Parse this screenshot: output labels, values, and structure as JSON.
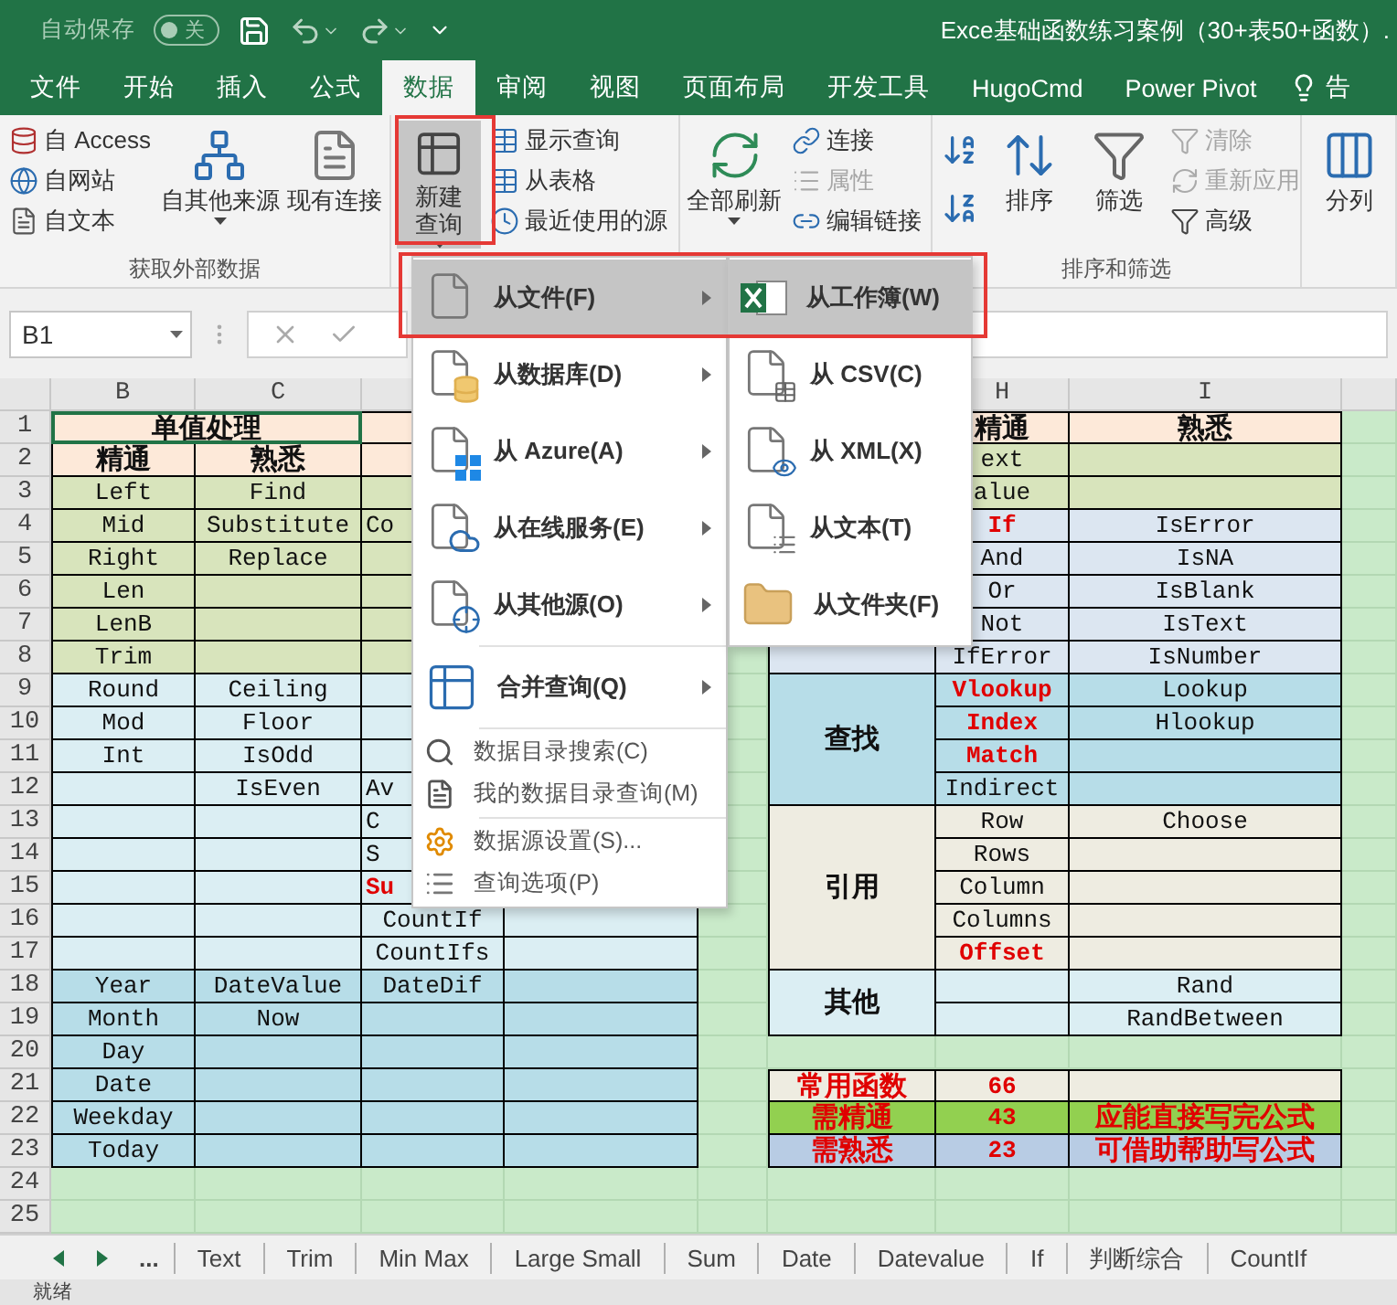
{
  "titlebar": {
    "autosave_label": "自动保存",
    "autosave": {
      "label": "关",
      "on": false
    },
    "title": "Exce基础函数练习案例（30+表50+函数）."
  },
  "ribbon_tabs": [
    {
      "label": "文件",
      "selected": false
    },
    {
      "label": "开始",
      "selected": false
    },
    {
      "label": "插入",
      "selected": false
    },
    {
      "label": "公式",
      "selected": false
    },
    {
      "label": "数据",
      "selected": true
    },
    {
      "label": "审阅",
      "selected": false
    },
    {
      "label": "视图",
      "selected": false
    },
    {
      "label": "页面布局",
      "selected": false
    },
    {
      "label": "开发工具",
      "selected": false
    },
    {
      "label": "HugoCmd",
      "selected": false
    },
    {
      "label": "Power Pivot",
      "selected": false
    }
  ],
  "tell_me": "告",
  "ribbon": {
    "groups": [
      {
        "label": "获取外部数据",
        "controls": [
          {
            "kind": "stack",
            "items": [
              {
                "label": "自 Access",
                "disabled": false
              },
              {
                "label": "自网站",
                "disabled": false
              },
              {
                "label": "自文本",
                "disabled": false
              }
            ]
          },
          {
            "kind": "large",
            "label": "自其他来源",
            "dropdown": true,
            "pressed": false
          },
          {
            "kind": "large",
            "label": "现有连接",
            "dropdown": false,
            "pressed": false
          }
        ]
      },
      {
        "controls": [
          {
            "kind": "large",
            "label": "新建查询",
            "dropdown": true,
            "pressed": true
          },
          {
            "kind": "stack",
            "items": [
              {
                "label": "显示查询",
                "disabled": false
              },
              {
                "label": "从表格",
                "disabled": false
              },
              {
                "label": "最近使用的源",
                "disabled": false
              }
            ]
          }
        ]
      },
      {
        "controls": [
          {
            "kind": "large",
            "label": "全部刷新",
            "dropdown": true,
            "pressed": false
          },
          {
            "kind": "stack",
            "items": [
              {
                "label": "连接",
                "disabled": false
              },
              {
                "label": "属性",
                "disabled": true
              },
              {
                "label": "编辑链接",
                "disabled": false
              }
            ]
          }
        ]
      },
      {
        "label": "排序和筛选",
        "controls": [
          {
            "kind": "sort-pair"
          },
          {
            "kind": "large",
            "label": "排序",
            "dropdown": false,
            "pressed": false
          },
          {
            "kind": "large",
            "label": "筛选",
            "dropdown": false,
            "pressed": false
          },
          {
            "kind": "stack",
            "items": [
              {
                "label": "清除",
                "disabled": true
              },
              {
                "label": "重新应用",
                "disabled": true
              },
              {
                "label": "高级",
                "disabled": false
              }
            ]
          }
        ]
      },
      {
        "controls": [
          {
            "kind": "large",
            "label": "分列",
            "dropdown": false,
            "pressed": false
          }
        ]
      }
    ]
  },
  "formula_bar": {
    "name_box": "B1"
  },
  "query_menu": {
    "sections": [
      [
        {
          "label": "从文件(F)",
          "selected": true
        },
        {
          "label": "从数据库(D)",
          "selected": false
        },
        {
          "label": "从 Azure(A)",
          "selected": false
        },
        {
          "label": "从在线服务(E)",
          "selected": false
        },
        {
          "label": "从其他源(O)",
          "selected": false
        }
      ],
      [
        {
          "label": "合并查询(Q)",
          "selected": false
        }
      ],
      [
        {
          "label": "数据目录搜索(C)",
          "selected": false
        },
        {
          "label": "我的数据目录查询(M)",
          "selected": false
        }
      ],
      [
        {
          "label": "数据源设置(S)...",
          "selected": false
        },
        {
          "label": "查询选项(P)",
          "selected": false
        }
      ]
    ],
    "submenu": [
      {
        "label": "从工作簿(W)",
        "selected": true
      },
      {
        "label": "从 CSV(C)",
        "selected": false
      },
      {
        "label": "从 XML(X)",
        "selected": false
      },
      {
        "label": "从文本(T)",
        "selected": false
      },
      {
        "label": "从文件夹(F)",
        "selected": false
      }
    ]
  },
  "sheet": {
    "column_headers": [
      "B",
      "C",
      "H",
      "I"
    ],
    "row_numbers": [
      "1",
      "2",
      "3",
      "4",
      "5",
      "6",
      "7",
      "8",
      "9",
      "10",
      "11",
      "12",
      "13",
      "14",
      "15",
      "16",
      "17",
      "18",
      "19",
      "20",
      "21",
      "22",
      "23",
      "24",
      "25"
    ],
    "left_table": {
      "title": "单值处理",
      "header": [
        "精通",
        "熟悉"
      ],
      "rows": [
        {
          "kind": "text",
          "b": {
            "text": "Left",
            "emphasis": false
          },
          "c": {
            "text": "Find",
            "emphasis": false
          }
        },
        {
          "kind": "text",
          "b": {
            "text": "Mid",
            "emphasis": false
          },
          "c": {
            "text": "Substitute",
            "emphasis": false
          },
          "d": {
            "text": "Co",
            "emphasis": false
          }
        },
        {
          "kind": "text",
          "b": {
            "text": "Right",
            "emphasis": false
          },
          "c": {
            "text": "Replace",
            "emphasis": false
          }
        },
        {
          "kind": "text",
          "b": {
            "text": "Len",
            "emphasis": false
          }
        },
        {
          "kind": "text",
          "b": {
            "text": "LenB",
            "emphasis": false
          }
        },
        {
          "kind": "text",
          "b": {
            "text": "Trim",
            "emphasis": false
          }
        },
        {
          "kind": "math",
          "b": {
            "text": "Round",
            "emphasis": false
          },
          "c": {
            "text": "Ceiling",
            "emphasis": false
          }
        },
        {
          "kind": "math",
          "b": {
            "text": "Mod",
            "emphasis": false
          },
          "c": {
            "text": "Floor",
            "emphasis": false
          }
        },
        {
          "kind": "math",
          "b": {
            "text": "Int",
            "emphasis": false
          },
          "c": {
            "text": "IsOdd",
            "emphasis": false
          }
        },
        {
          "kind": "math",
          "c": {
            "text": "IsEven",
            "emphasis": false
          },
          "d": {
            "text": "Av",
            "emphasis": false
          }
        },
        {
          "kind": "math",
          "d": {
            "text": "C",
            "emphasis": false
          }
        },
        {
          "kind": "math",
          "d": {
            "text": "S",
            "emphasis": false
          }
        },
        {
          "kind": "math",
          "d": {
            "text": "Su",
            "emphasis": true
          }
        },
        {
          "kind": "math",
          "d": {
            "text": "CountIf",
            "emphasis": false
          }
        },
        {
          "kind": "math",
          "d": {
            "text": "CountIfs",
            "emphasis": false
          }
        },
        {
          "kind": "date",
          "b": {
            "text": "Year",
            "emphasis": false
          },
          "c": {
            "text": "DateValue",
            "emphasis": false
          },
          "d": {
            "text": "DateDif",
            "emphasis": false
          }
        },
        {
          "kind": "date",
          "b": {
            "text": "Month",
            "emphasis": false
          },
          "c": {
            "text": "Now",
            "emphasis": false
          }
        },
        {
          "kind": "date",
          "b": {
            "text": "Day",
            "emphasis": false
          }
        },
        {
          "kind": "date",
          "b": {
            "text": "Date",
            "emphasis": false
          }
        },
        {
          "kind": "date",
          "b": {
            "text": "Weekday",
            "emphasis": false
          }
        },
        {
          "kind": "date",
          "b": {
            "text": "Today",
            "emphasis": false
          }
        }
      ]
    },
    "right_table": {
      "header": [
        "精通",
        "熟悉"
      ],
      "groups": [
        {
          "kind": "text",
          "rows": [
            {
              "h": {
                "text": "ext",
                "emphasis": false
              }
            },
            {
              "h": {
                "text": "alue",
                "emphasis": false
              }
            }
          ]
        },
        {
          "kind": "logic",
          "rows": [
            {
              "h": {
                "text": "If",
                "emphasis": true
              },
              "i": {
                "text": "IsError",
                "emphasis": false
              }
            },
            {
              "h": {
                "text": "And",
                "emphasis": false
              },
              "i": {
                "text": "IsNA",
                "emphasis": false
              }
            },
            {
              "h": {
                "text": "Or",
                "emphasis": false
              },
              "i": {
                "text": "IsBlank",
                "emphasis": false
              }
            },
            {
              "h": {
                "text": "Not",
                "emphasis": false
              },
              "i": {
                "text": "IsText",
                "emphasis": false
              }
            },
            {
              "h": {
                "text": "IfError",
                "emphasis": false
              },
              "i": {
                "text": "IsNumber",
                "emphasis": false
              }
            }
          ]
        },
        {
          "label": "查找",
          "kind": "lookup",
          "rows": [
            {
              "h": {
                "text": "Vlookup",
                "emphasis": true
              },
              "i": {
                "text": "Lookup",
                "emphasis": false
              }
            },
            {
              "h": {
                "text": "Index",
                "emphasis": true
              },
              "i": {
                "text": "Hlookup",
                "emphasis": false
              }
            },
            {
              "h": {
                "text": "Match",
                "emphasis": true
              }
            },
            {
              "h": {
                "text": "Indirect",
                "emphasis": false
              }
            }
          ]
        },
        {
          "label": "引用",
          "kind": "reference",
          "rows": [
            {
              "h": {
                "text": "Row",
                "emphasis": false
              },
              "i": {
                "text": "Choose",
                "emphasis": false
              }
            },
            {
              "h": {
                "text": "Rows",
                "emphasis": false
              }
            },
            {
              "h": {
                "text": "Column",
                "emphasis": false
              }
            },
            {
              "h": {
                "text": "Columns",
                "emphasis": false
              }
            },
            {
              "h": {
                "text": "Offset",
                "emphasis": true
              }
            }
          ]
        },
        {
          "label": "其他",
          "kind": "other",
          "rows": [
            {
              "i": {
                "text": "Rand",
                "emphasis": false
              }
            },
            {
              "i": {
                "text": "RandBetween",
                "emphasis": false
              }
            }
          ]
        }
      ]
    },
    "summary": [
      {
        "kind": "reference",
        "label": "常用函数",
        "count": "66"
      },
      {
        "kind": "master",
        "label": "需精通",
        "count": "43",
        "note": "应能直接写完公式"
      },
      {
        "kind": "familiar",
        "label": "需熟悉",
        "count": "23",
        "note": "可借助帮助写公式"
      }
    ]
  },
  "sheet_tabs": {
    "more": "...",
    "tabs": [
      {
        "label": "Text",
        "selected": false
      },
      {
        "label": "Trim",
        "selected": false
      },
      {
        "label": "Min Max",
        "selected": false
      },
      {
        "label": "Large Small",
        "selected": false
      },
      {
        "label": "Sum",
        "selected": false
      },
      {
        "label": "Date",
        "selected": false
      },
      {
        "label": "Datevalue",
        "selected": false
      },
      {
        "label": "If",
        "selected": false
      },
      {
        "label": "判断综合",
        "selected": false
      },
      {
        "label": "CountIf",
        "selected": false
      }
    ]
  },
  "status_bar": "就绪"
}
